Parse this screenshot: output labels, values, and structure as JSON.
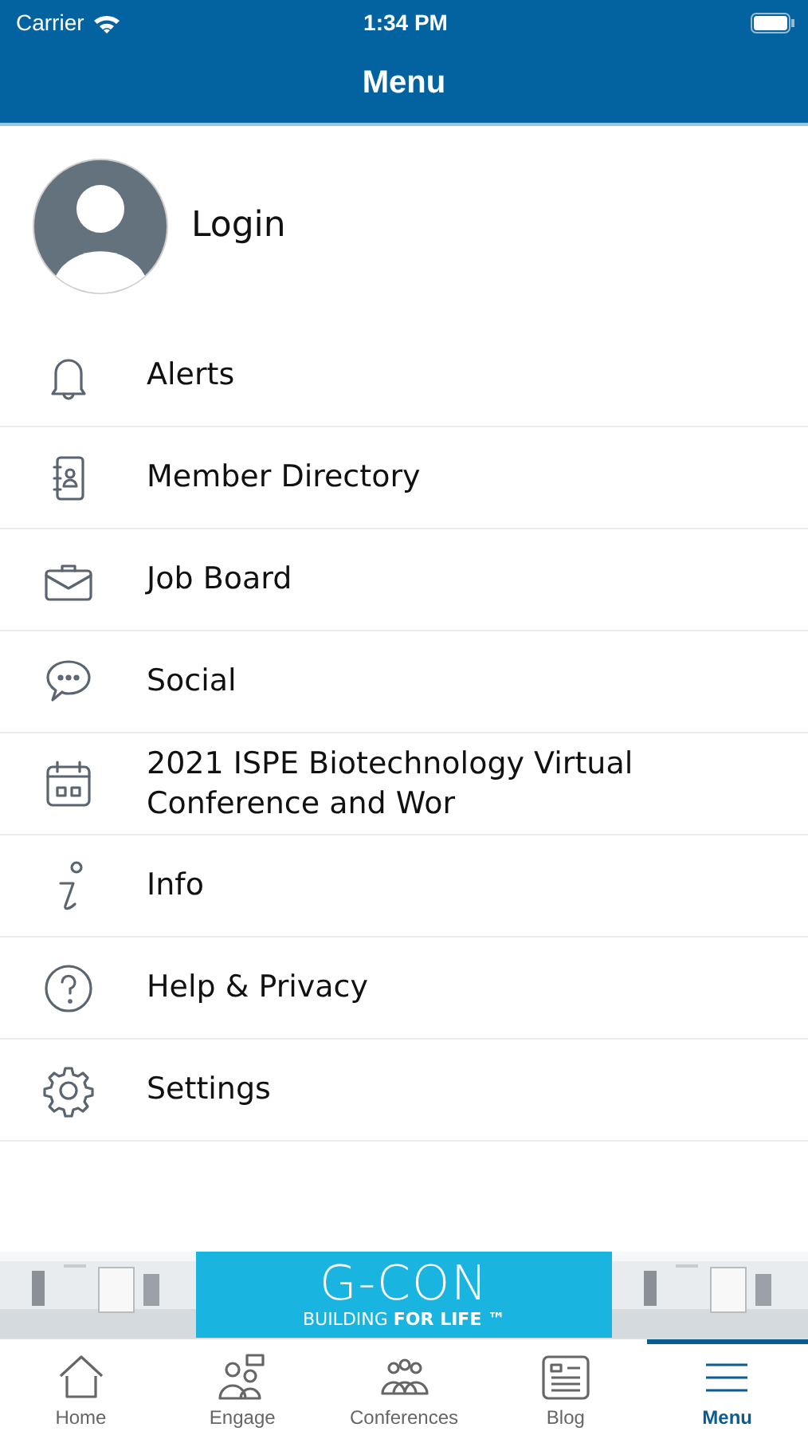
{
  "status_bar": {
    "carrier": "Carrier",
    "time": "1:34 PM"
  },
  "header": {
    "title": "Menu"
  },
  "profile": {
    "label": "Login"
  },
  "menu_items": [
    {
      "label": "Alerts"
    },
    {
      "label": "Member Directory"
    },
    {
      "label": "Job Board"
    },
    {
      "label": "Social"
    },
    {
      "label": "2021 ISPE Biotechnology Virtual Conference and Wor"
    },
    {
      "label": "Info"
    },
    {
      "label": "Help & Privacy"
    },
    {
      "label": "Settings"
    }
  ],
  "banner": {
    "logo": "G-CON",
    "tagline_start": "BUILDING",
    "tagline_bold": "FOR LIFE ™"
  },
  "tab_bar": [
    {
      "label": "Home",
      "selected": false
    },
    {
      "label": "Engage",
      "selected": false
    },
    {
      "label": "Conferences",
      "selected": false
    },
    {
      "label": "Blog",
      "selected": false
    },
    {
      "label": "Menu",
      "selected": true
    }
  ]
}
